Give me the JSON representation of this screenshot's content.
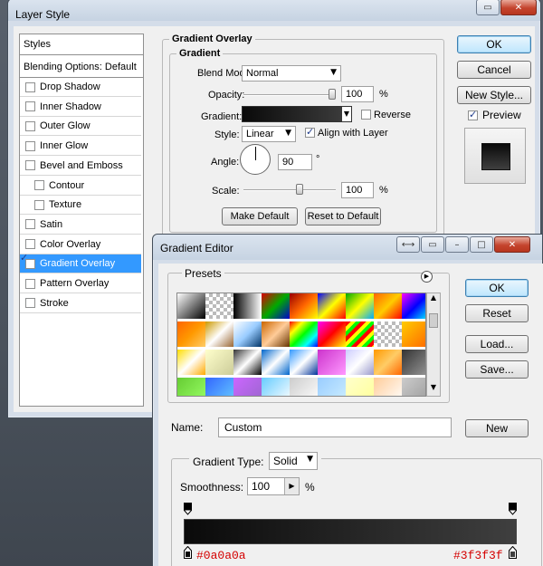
{
  "layer_style": {
    "title": "Layer Style",
    "buttons": {
      "ok": "OK",
      "cancel": "Cancel",
      "new_style": "New Style...",
      "preview": "Preview"
    },
    "styles_header": "Styles",
    "blending": "Blending Options: Default",
    "styles": [
      {
        "label": "Drop Shadow",
        "checked": false,
        "sub": false,
        "active": false
      },
      {
        "label": "Inner Shadow",
        "checked": false,
        "sub": false,
        "active": false
      },
      {
        "label": "Outer Glow",
        "checked": false,
        "sub": false,
        "active": false
      },
      {
        "label": "Inner Glow",
        "checked": false,
        "sub": false,
        "active": false
      },
      {
        "label": "Bevel and Emboss",
        "checked": false,
        "sub": false,
        "active": false
      },
      {
        "label": "Contour",
        "checked": false,
        "sub": true,
        "active": false
      },
      {
        "label": "Texture",
        "checked": false,
        "sub": true,
        "active": false
      },
      {
        "label": "Satin",
        "checked": false,
        "sub": false,
        "active": false
      },
      {
        "label": "Color Overlay",
        "checked": false,
        "sub": false,
        "active": false
      },
      {
        "label": "Gradient Overlay",
        "checked": true,
        "sub": false,
        "active": true
      },
      {
        "label": "Pattern Overlay",
        "checked": false,
        "sub": false,
        "active": false
      },
      {
        "label": "Stroke",
        "checked": false,
        "sub": false,
        "active": false
      }
    ],
    "section": "Gradient Overlay",
    "group": "Gradient",
    "blend_mode_label": "Blend Mode:",
    "blend_mode": "Normal",
    "opacity_label": "Opacity:",
    "opacity": "100",
    "percent": "%",
    "gradient_label": "Gradient:",
    "reverse": "Reverse",
    "style_label": "Style:",
    "style": "Linear",
    "align": "Align with Layer",
    "angle_label": "Angle:",
    "angle": "90",
    "degree": "°",
    "scale_label": "Scale:",
    "scale": "100",
    "make_default": "Make Default",
    "reset_default": "Reset to Default"
  },
  "gradient_editor": {
    "title": "Gradient Editor",
    "presets": "Presets",
    "buttons": {
      "ok": "OK",
      "reset": "Reset",
      "load": "Load...",
      "save": "Save...",
      "new": "New"
    },
    "name_label": "Name:",
    "name": "Custom",
    "type_label": "Gradient Type:",
    "type": "Solid",
    "smooth_label": "Smoothness:",
    "smooth": "100",
    "percent": "%",
    "stop_left": "#0a0a0a",
    "stop_right": "#3f3f3f"
  },
  "colors": {
    "accent": "#3399ff",
    "stop_text": "#d40000",
    "grad_start": "#0a0a0a",
    "grad_end": "#3f3f3f"
  },
  "icons": [
    "checkbox-icon",
    "dropdown-arrow-icon",
    "flyout-arrow-icon",
    "minimize-icon",
    "maximize-icon",
    "close-icon",
    "scroll-up-icon",
    "scroll-down-icon",
    "color-stop-icon",
    "opacity-stop-icon"
  ]
}
